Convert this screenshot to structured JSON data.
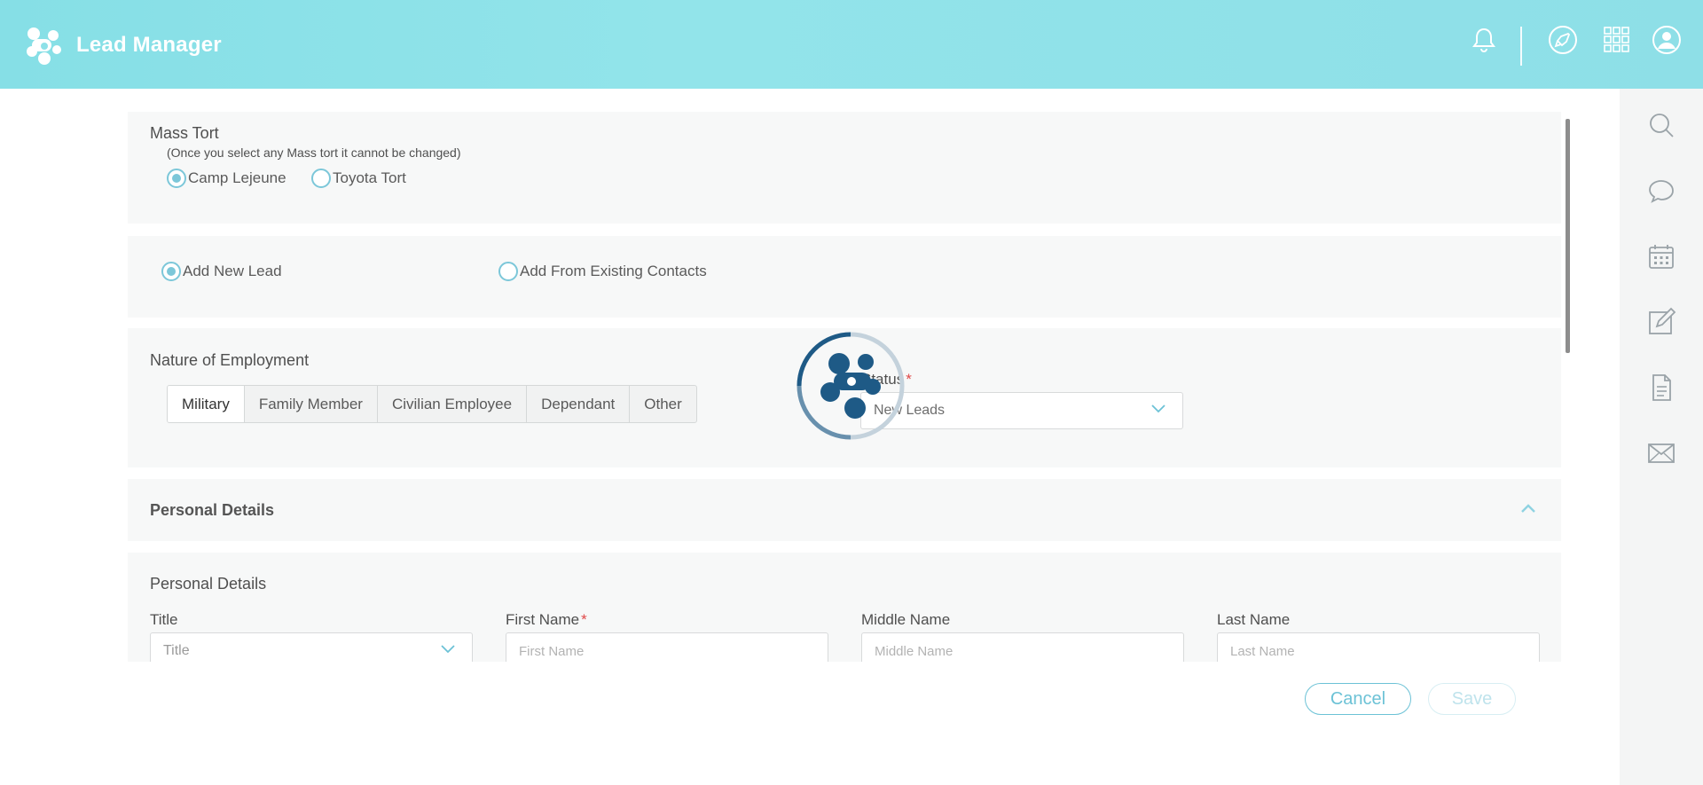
{
  "app": {
    "title": "Lead Manager"
  },
  "header_icons": [
    "bell-icon",
    "rocket-icon",
    "apps-grid-icon",
    "user-avatar-icon"
  ],
  "sidebar_icons": [
    "search-icon",
    "chat-icon",
    "calendar-icon",
    "edit-icon",
    "document-icon",
    "mail-icon"
  ],
  "mass_tort": {
    "title": "Mass Tort",
    "note": "(Once you select any Mass tort it cannot be changed)",
    "options": [
      {
        "label": "Camp Lejeune",
        "checked": true
      },
      {
        "label": "Toyota Tort",
        "checked": false
      }
    ]
  },
  "lead_source": {
    "options": [
      {
        "label": "Add New Lead",
        "checked": true
      },
      {
        "label": "Add From Existing Contacts",
        "checked": false
      }
    ]
  },
  "employment": {
    "title": "Nature of Employment",
    "options": [
      "Military",
      "Family Member",
      "Civilian Employee",
      "Dependant",
      "Other"
    ],
    "selected": "Military",
    "status_label": "Status",
    "status_value": "New Leads"
  },
  "personal_collapsible": {
    "title": "Personal Details"
  },
  "personal": {
    "title": "Personal Details",
    "fields": [
      {
        "label": "Title",
        "required": false,
        "placeholder": "Title",
        "type": "select"
      },
      {
        "label": "First Name",
        "required": true,
        "placeholder": "First Name",
        "type": "input"
      },
      {
        "label": "Middle Name",
        "required": false,
        "placeholder": "Middle Name",
        "type": "input"
      },
      {
        "label": "Last Name",
        "required": false,
        "placeholder": "Last Name",
        "type": "input"
      }
    ]
  },
  "actions": {
    "cancel": "Cancel",
    "save": "Save"
  },
  "colors": {
    "header": "#8ee1e8",
    "accent": "#6cc2d6",
    "required": "#e04848",
    "spinner": "#1e5a86"
  }
}
